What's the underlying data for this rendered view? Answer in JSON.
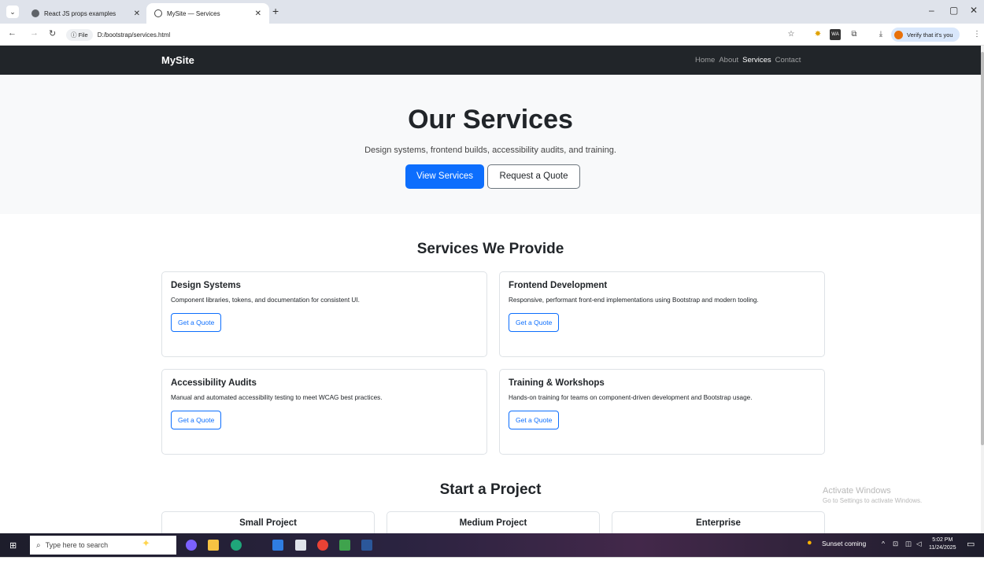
{
  "browser": {
    "tabs": [
      {
        "label": "React JS props examples",
        "favicon_color": "#5f6368"
      },
      {
        "label": "MySite — Services",
        "favicon_color": "#5f6368"
      }
    ],
    "new_tab_symbol": "+",
    "address": {
      "security_label": "File",
      "url": "D:/bootstrap/services.html"
    },
    "profile_label": "Verify that it's you",
    "window_controls": [
      "–",
      "▢",
      "✕"
    ]
  },
  "site": {
    "brand": "MySite",
    "nav": [
      {
        "label": "Home",
        "active": false
      },
      {
        "label": "About",
        "active": false
      },
      {
        "label": "Services",
        "active": true
      },
      {
        "label": "Contact",
        "active": false
      }
    ]
  },
  "hero": {
    "title": "Our Services",
    "subtitle": "Design systems, frontend builds, accessibility audits, and training.",
    "primary_button": "View Services",
    "secondary_button": "Request a Quote"
  },
  "services": {
    "title": "Services We Provide",
    "items": [
      {
        "title": "Design Systems",
        "description": "Component libraries, tokens, and documentation for consistent UI.",
        "button": "Get a Quote"
      },
      {
        "title": "Frontend Development",
        "description": "Responsive, performant front-end implementations using Bootstrap and modern tooling.",
        "button": "Get a Quote"
      },
      {
        "title": "Accessibility Audits",
        "description": "Manual and automated accessibility testing to meet WCAG best practices.",
        "button": "Get a Quote"
      },
      {
        "title": "Training & Workshops",
        "description": "Hands-on training for teams on component-driven development and Bootstrap usage.",
        "button": "Get a Quote"
      }
    ]
  },
  "project": {
    "title": "Start a Project",
    "plans": [
      "Small Project",
      "Medium Project",
      "Enterprise"
    ]
  },
  "watermark": {
    "line1": "Activate Windows",
    "line2": "Go to Settings to activate Windows."
  },
  "taskbar": {
    "search_placeholder": "Type here to search",
    "weather": "Sunset coming",
    "time": "5:02 PM",
    "date": "11/24/2025"
  },
  "colors": {
    "primary": "#0d6efd",
    "navbar": "#212529",
    "hero_bg": "#f8f9fa"
  }
}
